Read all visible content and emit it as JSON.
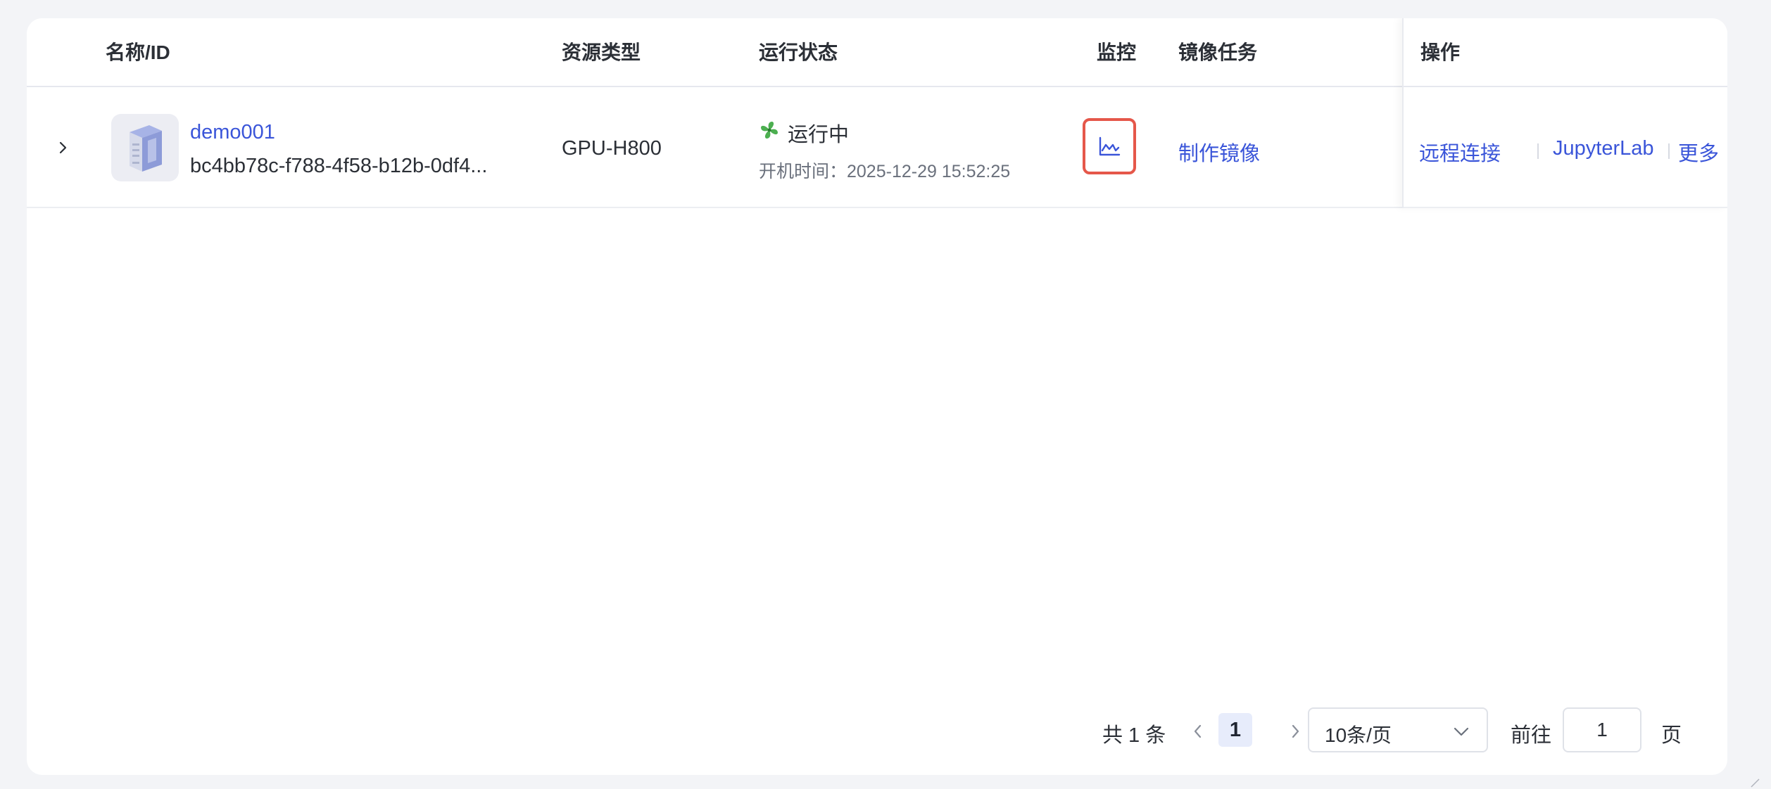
{
  "table": {
    "columns": {
      "name_id": "名称/ID",
      "resource_type": "资源类型",
      "run_status": "运行状态",
      "monitor": "监控",
      "mirror_task": "镜像任务",
      "actions": "操作"
    },
    "rows": [
      {
        "name": "demo001",
        "id": "bc4bb78c-f788-4f58-b12b-0df4...",
        "resource_type": "GPU-H800",
        "status": "运行中",
        "boot_time": "开机时间：2025-12-29 15:52:25",
        "mirror_action": "制作镜像",
        "actions": [
          "远程连接",
          "JupyterLab",
          "更多"
        ]
      }
    ]
  },
  "pagination": {
    "total": "共 1 条",
    "current_page": "1",
    "page_size": "10条/页",
    "goto_label": "前往",
    "goto_value": "1",
    "page_unit": "页"
  },
  "colors": {
    "link": "#3a55d9",
    "status_running": "#4caf50",
    "monitor_highlight": "#e5574a"
  },
  "icons": {
    "expand": "chevron-right-icon",
    "instance": "server-icon",
    "status": "fan-icon",
    "monitor": "line-chart-icon",
    "prev": "chevron-left-icon",
    "next": "chevron-right-icon",
    "dropdown": "chevron-down-icon"
  }
}
